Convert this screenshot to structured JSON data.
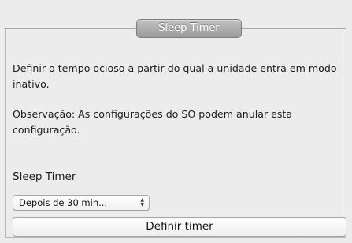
{
  "section": {
    "title": "Sleep Timer",
    "description": "Definir o tempo ocioso a partir do qual a unidade entra em modo inativo.",
    "note": "Observação: As configurações do SO podem anular esta configuração.",
    "field_label": "Sleep Timer",
    "select_value": "Depois de 30 min...",
    "select_arrow_icon": "up-down-arrows-icon",
    "button_label": "Definir timer"
  }
}
